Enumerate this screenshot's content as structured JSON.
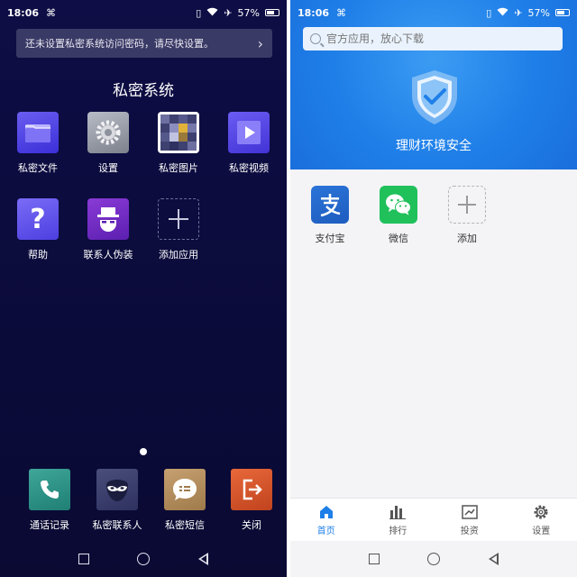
{
  "left_screen": {
    "status": {
      "time": "18:06",
      "battery": "57%"
    },
    "notice": {
      "text": "还未设置私密系统访问密码，请尽快设置。"
    },
    "title": "私密系统",
    "apps": [
      {
        "label": "私密文件"
      },
      {
        "label": "设置"
      },
      {
        "label": "私密图片"
      },
      {
        "label": "私密视频"
      },
      {
        "label": "帮助"
      },
      {
        "label": "联系人伪装"
      },
      {
        "label": "添加应用"
      }
    ],
    "dock": [
      {
        "label": "通话记录"
      },
      {
        "label": "私密联系人"
      },
      {
        "label": "私密短信"
      },
      {
        "label": "关闭"
      }
    ]
  },
  "right_screen": {
    "status": {
      "time": "18:06",
      "battery": "57%"
    },
    "search": {
      "placeholder": "官方应用，放心下载"
    },
    "security_label": "理财环境安全",
    "apps": [
      {
        "label": "支付宝"
      },
      {
        "label": "微信"
      },
      {
        "label": "添加"
      }
    ],
    "tabs": [
      {
        "label": "首页"
      },
      {
        "label": "排行"
      },
      {
        "label": "投资"
      },
      {
        "label": "设置"
      }
    ]
  },
  "colors": {
    "left_background": "#0b0b3a",
    "right_accent": "#1f7fe8",
    "wechat_green": "#20c05b"
  }
}
